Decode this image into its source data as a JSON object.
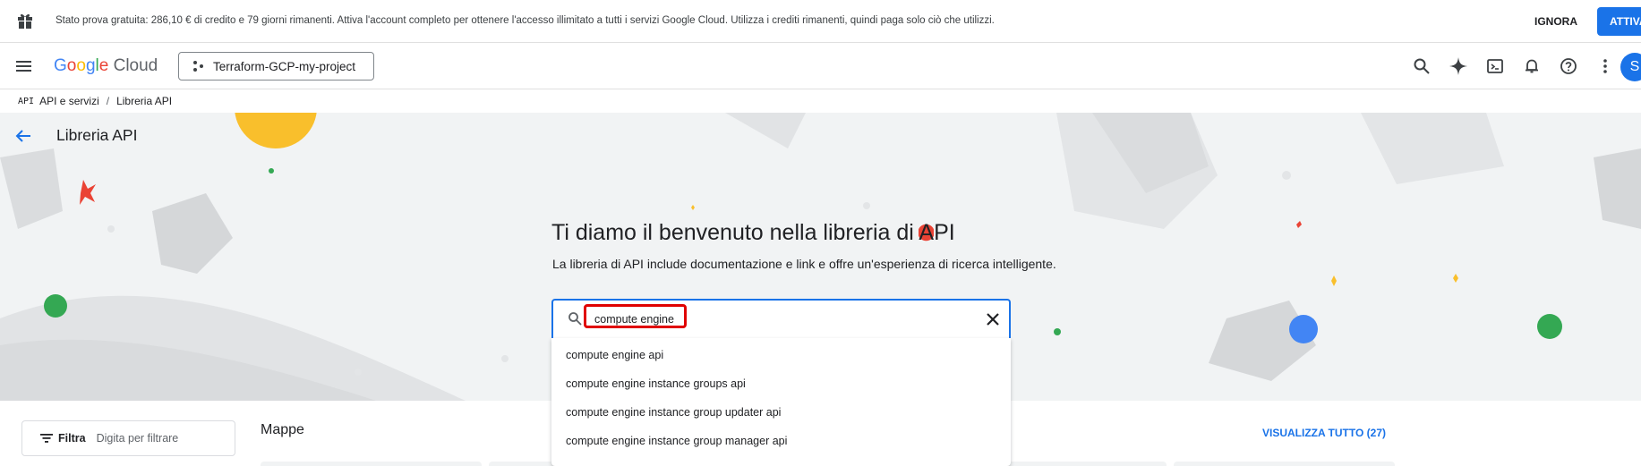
{
  "banner": {
    "text": "Stato prova gratuita: 286,10 € di credito e 79 giorni rimanenti. Attiva l'account completo per ottenere l'accesso illimitato a tutti i servizi Google Cloud. Utilizza i crediti rimanenti, quindi paga solo ciò che utilizzi.",
    "ignore_label": "IGNORA",
    "activate_label": "ATTIVA"
  },
  "topbar": {
    "logo_google": "Google",
    "logo_cloud": "Cloud",
    "project_name": "Terraform-GCP-my-project",
    "avatar_letter": "S"
  },
  "breadcrumb": {
    "icon_text": "API",
    "items": [
      "API e servizi",
      "Libreria API"
    ]
  },
  "page": {
    "title": "Libreria API",
    "welcome_title_pre": "Ti diamo il benvenuto nella libreria di ",
    "welcome_title_a": "A",
    "welcome_title_post": "PI",
    "welcome_subtitle": "La libreria di API include documentazione e link e offre un'esperienza di ricerca intelligente."
  },
  "search": {
    "value": "compute engine",
    "suggestions": [
      "compute engine api",
      "compute engine instance groups api",
      "compute engine instance group updater api",
      "compute engine instance group manager api"
    ]
  },
  "filter": {
    "label": "Filtra",
    "placeholder": "Digita per filtrare"
  },
  "section": {
    "title": "Mappe",
    "view_all": "VISUALIZZA TUTTO (27)"
  },
  "colors": {
    "accent": "#1a73e8",
    "highlight": "#e00000",
    "hero_bg": "#f1f3f4"
  }
}
